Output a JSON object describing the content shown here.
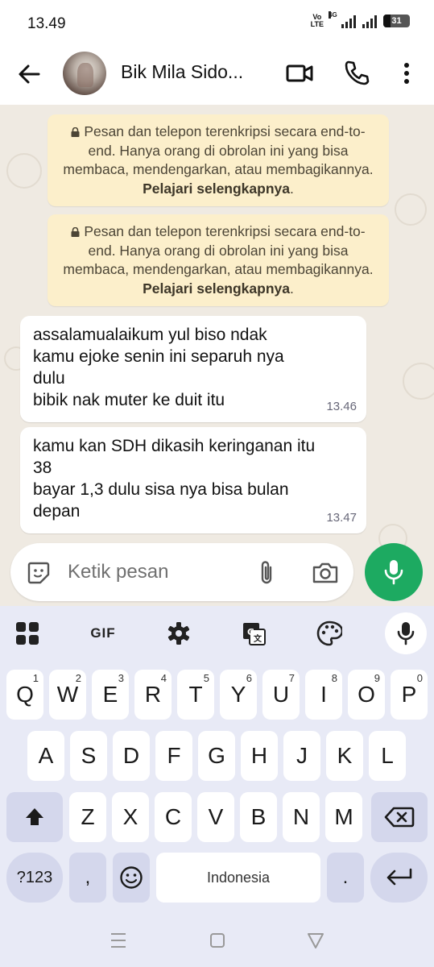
{
  "status_bar": {
    "time": "13.49",
    "volte_line1": "Vo",
    "volte_line2": "LTE",
    "network": "4G",
    "battery": "31"
  },
  "header": {
    "contact_name": "Bik Mila Sido...",
    "icons": [
      "back-arrow-icon",
      "video-call-icon",
      "phone-icon",
      "more-options-icon"
    ]
  },
  "chat": {
    "encryption_notices": [
      {
        "text": "Pesan dan telepon terenkripsi secara end-to-end. Hanya orang di obrolan ini yang bisa membaca, mendengarkan, atau membagikannya.",
        "link": "Pelajari selengkapnya"
      },
      {
        "text": "Pesan dan telepon terenkripsi secara end-to-end. Hanya orang di obrolan ini yang bisa membaca, mendengarkan, atau membagikannya.",
        "link": "Pelajari selengkapnya"
      }
    ],
    "messages": [
      {
        "text": "assalamualaikum yul biso ndak\nkamu ejoke senin ini separuh nya\ndulu\nbibik nak muter ke duit itu",
        "time": "13.46"
      },
      {
        "text": "kamu kan SDH dikasih keringanan itu\n38\nbayar 1,3 dulu sisa nya bisa bulan\ndepan",
        "time": "13.47"
      }
    ]
  },
  "composer": {
    "placeholder": "Ketik pesan"
  },
  "keyboard": {
    "toolbar": {
      "gif_label": "GIF"
    },
    "row1": [
      {
        "key": "Q",
        "sup": "1"
      },
      {
        "key": "W",
        "sup": "2"
      },
      {
        "key": "E",
        "sup": "3"
      },
      {
        "key": "R",
        "sup": "4"
      },
      {
        "key": "T",
        "sup": "5"
      },
      {
        "key": "Y",
        "sup": "6"
      },
      {
        "key": "U",
        "sup": "7"
      },
      {
        "key": "I",
        "sup": "8"
      },
      {
        "key": "O",
        "sup": "9"
      },
      {
        "key": "P",
        "sup": "0"
      }
    ],
    "row2": [
      "A",
      "S",
      "D",
      "F",
      "G",
      "H",
      "J",
      "K",
      "L"
    ],
    "row3": [
      "Z",
      "X",
      "C",
      "V",
      "B",
      "N",
      "M"
    ],
    "symbols_label": "?123",
    "comma_label": ",",
    "space_label": "Indonesia",
    "period_label": "."
  },
  "colors": {
    "chat_background": "#efeae2",
    "notice_background": "#fcefcb",
    "mic_button": "#1daa61",
    "keyboard_background": "#e8eaf6"
  }
}
